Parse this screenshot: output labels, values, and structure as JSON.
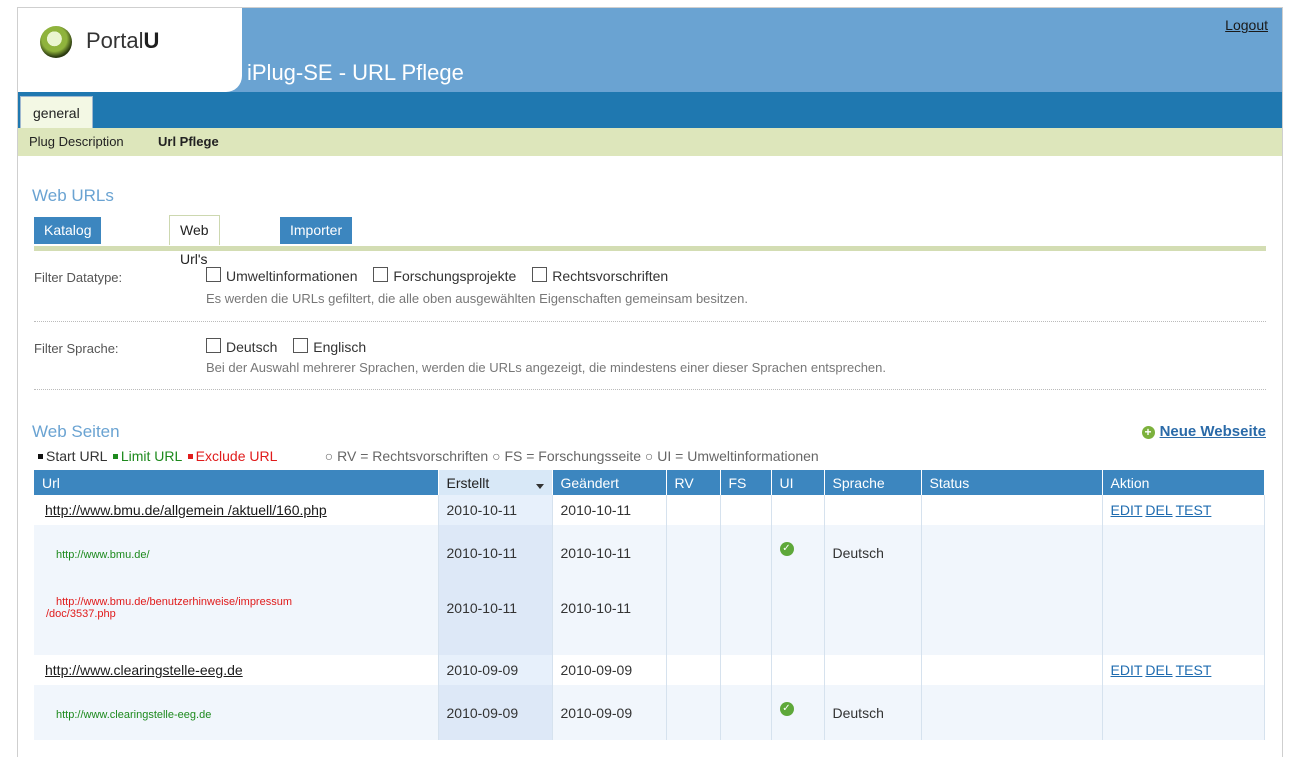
{
  "header": {
    "logo_text_a": "Portal",
    "logo_text_b": "U",
    "title": "iPlug-SE - URL Pflege",
    "logout": "Logout"
  },
  "tabs": {
    "general": "general"
  },
  "subnav": {
    "plug_description": "Plug Description",
    "url_pflege": "Url Pflege"
  },
  "web_urls": {
    "title": "Web URLs",
    "tabs": [
      "Katalog Url's",
      "Web Url's",
      "Importer"
    ],
    "active_tab": "Web Url's"
  },
  "filters": {
    "datatype": {
      "label": "Filter Datatype:",
      "options": [
        "Umweltinformationen",
        "Forschungsprojekte",
        "Rechtsvorschriften"
      ],
      "help": "Es werden die URLs gefiltert, die alle oben ausgewählten Eigenschaften gemeinsam besitzen."
    },
    "sprache": {
      "label": "Filter Sprache:",
      "options": [
        "Deutsch",
        "Englisch"
      ],
      "help": "Bei der Auswahl mehrerer Sprachen, werden die URLs angezeigt, die mindestens einer dieser Sprachen entsprechen."
    }
  },
  "web_seiten": {
    "title": "Web Seiten",
    "new_label": "Neue Webseite",
    "legend": {
      "start": "Start URL",
      "limit": "Limit URL",
      "exclude": "Exclude URL",
      "rv": "RV = Rechtsvorschriften",
      "fs": "FS = Forschungsseite",
      "ui": "UI = Umweltinformationen"
    },
    "columns": [
      "Url",
      "Erstellt",
      "Geändert",
      "RV",
      "FS",
      "UI",
      "Sprache",
      "Status",
      "Aktion"
    ],
    "actions": [
      "EDIT",
      "DEL",
      "TEST"
    ],
    "rows": [
      {
        "type": "start",
        "url": "http://www.bmu.de/allgemein /aktuell/160.php",
        "erstellt": "2010-10-11",
        "geaendert": "2010-10-11"
      },
      {
        "type": "limit",
        "url": "http://www.bmu.de/",
        "erstellt": "2010-10-11",
        "geaendert": "2010-10-11",
        "ui": true,
        "sprache": "Deutsch"
      },
      {
        "type": "exclude",
        "url_line1": "http://www.bmu.de/benutzerhinweise/impressum",
        "url_line2": "/doc/3537.php",
        "erstellt": "2010-10-11",
        "geaendert": "2010-10-11"
      },
      {
        "type": "start",
        "url": "http://www.clearingstelle-eeg.de",
        "erstellt": "2010-09-09",
        "geaendert": "2010-09-09"
      },
      {
        "type": "limit",
        "url": "http://www.clearingstelle-eeg.de",
        "erstellt": "2010-09-09",
        "geaendert": "2010-09-09",
        "ui": true,
        "sprache": "Deutsch"
      }
    ]
  },
  "colors": {
    "header_blue": "#6aa3d2",
    "tabbar_blue": "#1f78b0",
    "subnav_green": "#dde6bb",
    "limit_green": "#1d8a1d",
    "exclude_red": "#e01b1b"
  }
}
